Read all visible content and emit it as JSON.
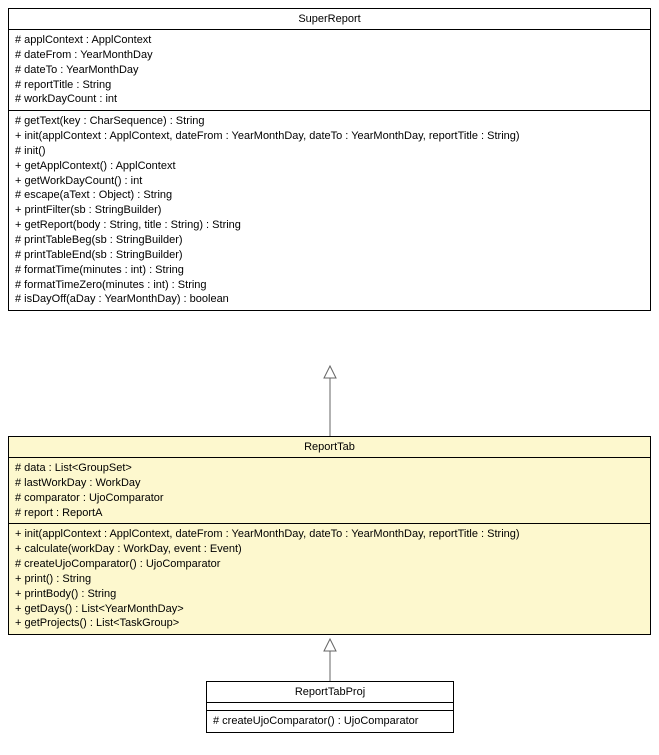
{
  "classes": {
    "superReport": {
      "name": "SuperReport",
      "attrs": [
        "# applContext : ApplContext",
        "# dateFrom : YearMonthDay",
        "# dateTo : YearMonthDay",
        "# reportTitle : String",
        "# workDayCount : int"
      ],
      "methods": [
        "# getText(key : CharSequence) : String",
        "+ init(applContext : ApplContext, dateFrom : YearMonthDay, dateTo : YearMonthDay, reportTitle : String)",
        "# init()",
        "+ getApplContext() : ApplContext",
        "+ getWorkDayCount() : int",
        "# escape(aText : Object) : String",
        "+ printFilter(sb : StringBuilder)",
        "+ getReport(body : String, title : String) : String",
        "# printTableBeg(sb : StringBuilder)",
        "# printTableEnd(sb : StringBuilder)",
        "# formatTime(minutes : int) : String",
        "# formatTimeZero(minutes : int) : String",
        "# isDayOff(aDay : YearMonthDay) : boolean"
      ]
    },
    "reportTab": {
      "name": "ReportTab",
      "attrs": [
        "# data : List<GroupSet>",
        "# lastWorkDay : WorkDay",
        "# comparator : UjoComparator",
        "# report : ReportA"
      ],
      "methods": [
        "+ init(applContext : ApplContext, dateFrom : YearMonthDay, dateTo : YearMonthDay, reportTitle : String)",
        "+ calculate(workDay : WorkDay, event : Event)",
        "# createUjoComparator() : UjoComparator",
        "+ print() : String",
        "+ printBody() : String",
        "+ getDays() : List<YearMonthDay>",
        "+ getProjects() : List<TaskGroup>"
      ]
    },
    "reportTabProj": {
      "name": "ReportTabProj",
      "attrs": [],
      "methods": [
        "# createUjoComparator() : UjoComparator"
      ]
    }
  }
}
